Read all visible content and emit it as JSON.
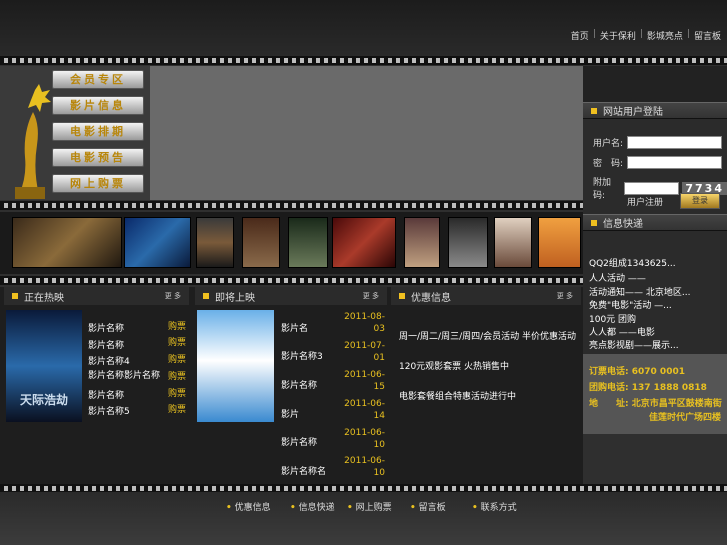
{
  "top_nav": [
    "首页",
    "关于保利",
    "影城亮点",
    "留言板"
  ],
  "menu": [
    "会员专区",
    "影片信息",
    "电影排期",
    "电影预告",
    "网上购票"
  ],
  "login": {
    "title": "网站用户登陆",
    "username_label": "用户名:",
    "password_label": "密　码:",
    "captcha_label": "附加码:",
    "captcha_code": "7734",
    "register": "用户注册"
  },
  "news": {
    "title": "信息快递",
    "items": [
      "QQ2组成1343625...",
      "人人活动 ——",
      "活动通知—— 北京地区...",
      "免费\"电影\"活动 —...",
      "100元 团购",
      "人人都 ——电影",
      "亮点影视剧——展示..."
    ]
  },
  "contact": {
    "ticket_label": "订票电话:",
    "ticket_phone": "6070 0001",
    "group_label": "团购电话:",
    "group_phone": "137 1888 0818",
    "address_label": "地　　址:",
    "address": "北京市昌平区鼓楼南街",
    "address2": "佳莲时代广场四楼"
  },
  "now_showing": {
    "title": "正在热映",
    "more": "更 多",
    "movies": [
      "天际浩劫",
      "影片名称",
      "影片名称4",
      "影片名称影片名称",
      "影片名称",
      "影片名称5"
    ],
    "buy": "购票"
  },
  "coming_soon": {
    "title": "即将上映",
    "more": "更 多",
    "movies": [
      "影片名",
      "影片名称3",
      "影片名称",
      "影片",
      "影片名称",
      "影片名称名"
    ],
    "dates": [
      "2011-08-03",
      "2011-07-01",
      "2011-06-15",
      "2011-06-14",
      "2011-06-10",
      "2011-06-10"
    ]
  },
  "promo": {
    "title": "优惠信息",
    "more": "更 多",
    "items": [
      "周一/周二/周三/周四/会员活动 半价优惠活动",
      "120元观影套票 火热销售中",
      "电影套餐组合特惠活动进行中"
    ]
  },
  "footer": [
    "优惠信息",
    "信息快递",
    "网上购票",
    "留言板",
    "联系方式"
  ],
  "colors": {
    "gold": "#e8c020",
    "dark": "#2f2f2f"
  }
}
